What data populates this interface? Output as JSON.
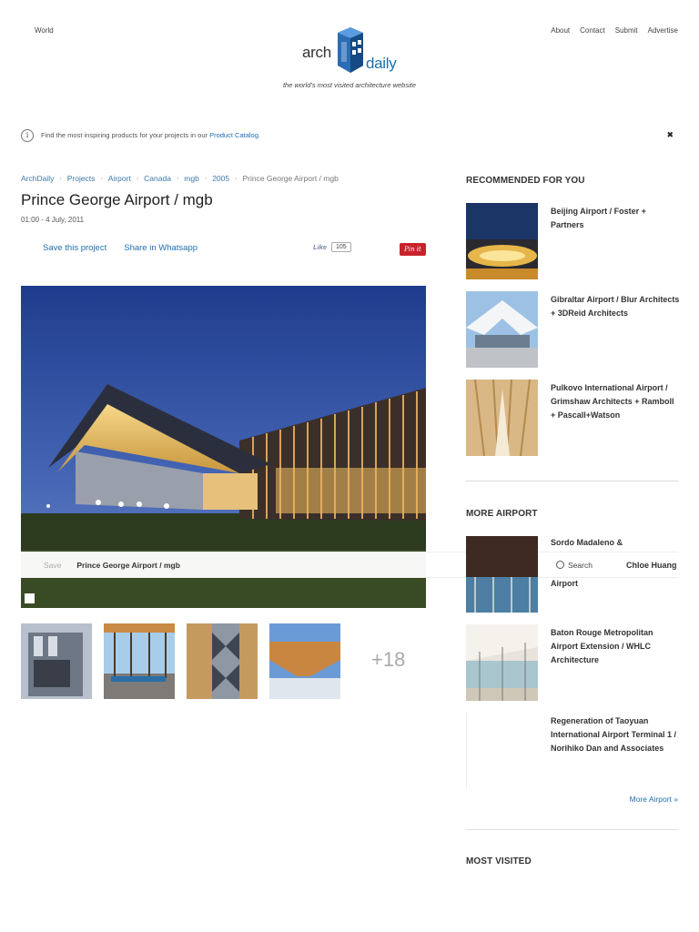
{
  "header": {
    "world_link": "World",
    "nav": [
      "About",
      "Contact",
      "Submit",
      "Advertise"
    ],
    "logo_arch": "arch",
    "logo_daily": "daily",
    "tagline": "the world's most visited architecture website"
  },
  "notice": {
    "text": "Find the most inspiring products for your projects in our ",
    "link": "Product Catalog",
    "suffix": ".",
    "close": "✖"
  },
  "breadcrumb": [
    "ArchDaily",
    "Projects",
    "Airport",
    "Canada",
    "mgb",
    "2005",
    "Prince George Airport / mgb"
  ],
  "article": {
    "title": "Prince George Airport / mgb",
    "date": "01:00 - 4 July, 2011",
    "save_label": "Save this project",
    "whatsapp_label": "Share in Whatsapp",
    "like_label": "Like",
    "like_count": "105",
    "pin_label": "Pin it"
  },
  "save_bar": {
    "save": "Save",
    "name": "Prince George Airport / mgb",
    "search": "Search",
    "user": "Chloe Huang"
  },
  "gallery": {
    "more_count": "+18"
  },
  "recommended": {
    "heading": "RECOMMENDED FOR YOU",
    "items": [
      "Beijing Airport / Foster + Partners",
      "Gibraltar Airport / Blur Architects + 3DReid Architects",
      "Pulkovo International Airport / Grimshaw Architects + Ramboll + Pascall+Watson"
    ]
  },
  "more_airport": {
    "heading": "MORE AIRPORT",
    "items": [
      "Sordo Madaleno & ... Airport",
      "Baton Rouge Metropolitan Airport Extension / WHLC Architecture",
      "Regeneration of Taoyuan International Airport Terminal 1 / Norihiko Dan and Associates"
    ],
    "item0_top": "Sordo Madaleno &",
    "item0_bottom": "Airport",
    "more_link": "More Airport »"
  },
  "most_visited": {
    "heading": "MOST VISITED"
  },
  "colors": {
    "link": "#1e6fb0",
    "pinterest": "#c8232c"
  }
}
